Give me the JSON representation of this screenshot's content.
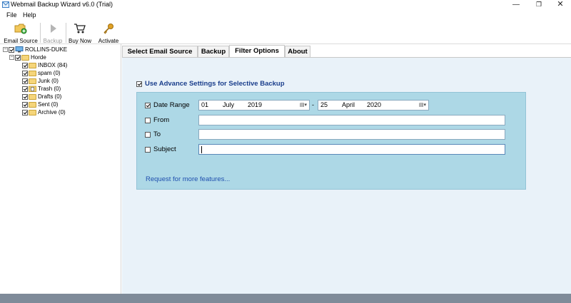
{
  "window": {
    "title": "Webmail Backup Wizard v6.0 (Trial)",
    "minimize": "—",
    "maximize": "❐",
    "close": "✕"
  },
  "menu": {
    "file": "File",
    "help": "Help"
  },
  "toolbar": {
    "email_source": "Email Source",
    "backup": "Backup",
    "buy_now": "Buy Now",
    "activate": "Activate"
  },
  "tree": {
    "root": "ROLLINS-DUKE",
    "account": "Horde",
    "folders": [
      {
        "label": "INBOX (84)"
      },
      {
        "label": "spam (0)"
      },
      {
        "label": "Junk (0)"
      },
      {
        "label": "Trash (0)"
      },
      {
        "label": "Drafts (0)"
      },
      {
        "label": "Sent (0)"
      },
      {
        "label": "Archive (0)"
      }
    ]
  },
  "tabs": [
    "Select Email Source",
    "Backup",
    "Filter Options",
    "About"
  ],
  "filter": {
    "advance_label": "Use Advance Settings for Selective Backup",
    "date_range_label": "Date Range",
    "date_from": {
      "day": "01",
      "month": "July",
      "year": "2019"
    },
    "date_sep": "-",
    "date_to": {
      "day": "25",
      "month": "April",
      "year": "2020"
    },
    "from_label": "From",
    "to_label": "To",
    "subject_label": "Subject",
    "more_features": "Request for more features..."
  }
}
